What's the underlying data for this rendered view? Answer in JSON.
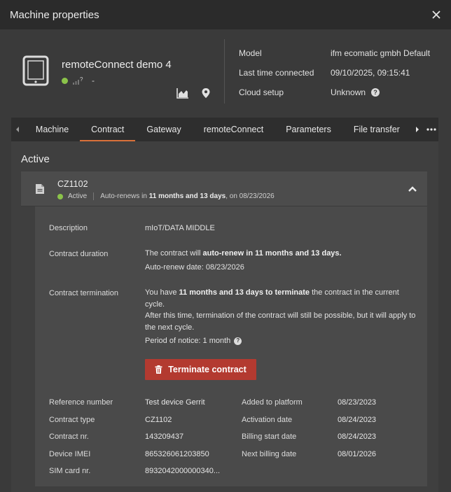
{
  "window": {
    "title": "Machine properties"
  },
  "device": {
    "name": "remoteConnect demo 4",
    "signal_suffix": "?",
    "status_dash": "-"
  },
  "properties": [
    {
      "label": "Model",
      "value": "ifm ecomatic gmbh Default"
    },
    {
      "label": "Last time connected",
      "value": "09/10/2025, 09:15:41"
    },
    {
      "label": "Cloud setup",
      "value": "Unknown"
    }
  ],
  "tabs": [
    {
      "label": "Machine"
    },
    {
      "label": "Contract",
      "active": true
    },
    {
      "label": "Gateway"
    },
    {
      "label": "remoteConnect"
    },
    {
      "label": "Parameters"
    },
    {
      "label": "File transfer"
    }
  ],
  "section": {
    "title": "Active"
  },
  "contract": {
    "id": "CZ1102",
    "status": "Active",
    "renew_prefix": "Auto-renews in",
    "renew_period": "11 months and 13 days",
    "renew_suffix": ", on 08/23/2026"
  },
  "details": {
    "description_label": "Description",
    "description_value": "mIoT/DATA MIDDLE",
    "duration_label": "Contract duration",
    "duration_line1_prefix": "The contract will",
    "duration_line1_bold": "auto-renew in 11 months and 13 days.",
    "duration_line2": "Auto-renew date: 08/23/2026",
    "termination_label": "Contract termination",
    "termination_prefix": "You have",
    "termination_bold": "11 months and 13 days to terminate",
    "termination_suffix": "the contract in the current cycle.",
    "termination_line2": "After this time, termination of the contract will still be possible, but it will apply to the next cycle.",
    "notice_text": "Period of notice: 1 month",
    "terminate_button": "Terminate contract"
  },
  "info_left": [
    {
      "label": "Reference number",
      "value": "Test device Gerrit"
    },
    {
      "label": "Contract type",
      "value": "CZ1102"
    },
    {
      "label": "Contract nr.",
      "value": "143209437"
    },
    {
      "label": "Device IMEI",
      "value": "865326061203850"
    },
    {
      "label": "SIM card nr.",
      "value": "8932042000000340..."
    }
  ],
  "info_right": [
    {
      "label": "Added to platform",
      "value": "08/23/2023"
    },
    {
      "label": "Activation date",
      "value": "08/24/2023"
    },
    {
      "label": "Billing start date",
      "value": "08/24/2023"
    },
    {
      "label": "Next billing date",
      "value": "08/01/2026"
    }
  ],
  "colors": {
    "accent": "#d9703a",
    "danger": "#b33a30",
    "status_green": "#8bc34a"
  }
}
